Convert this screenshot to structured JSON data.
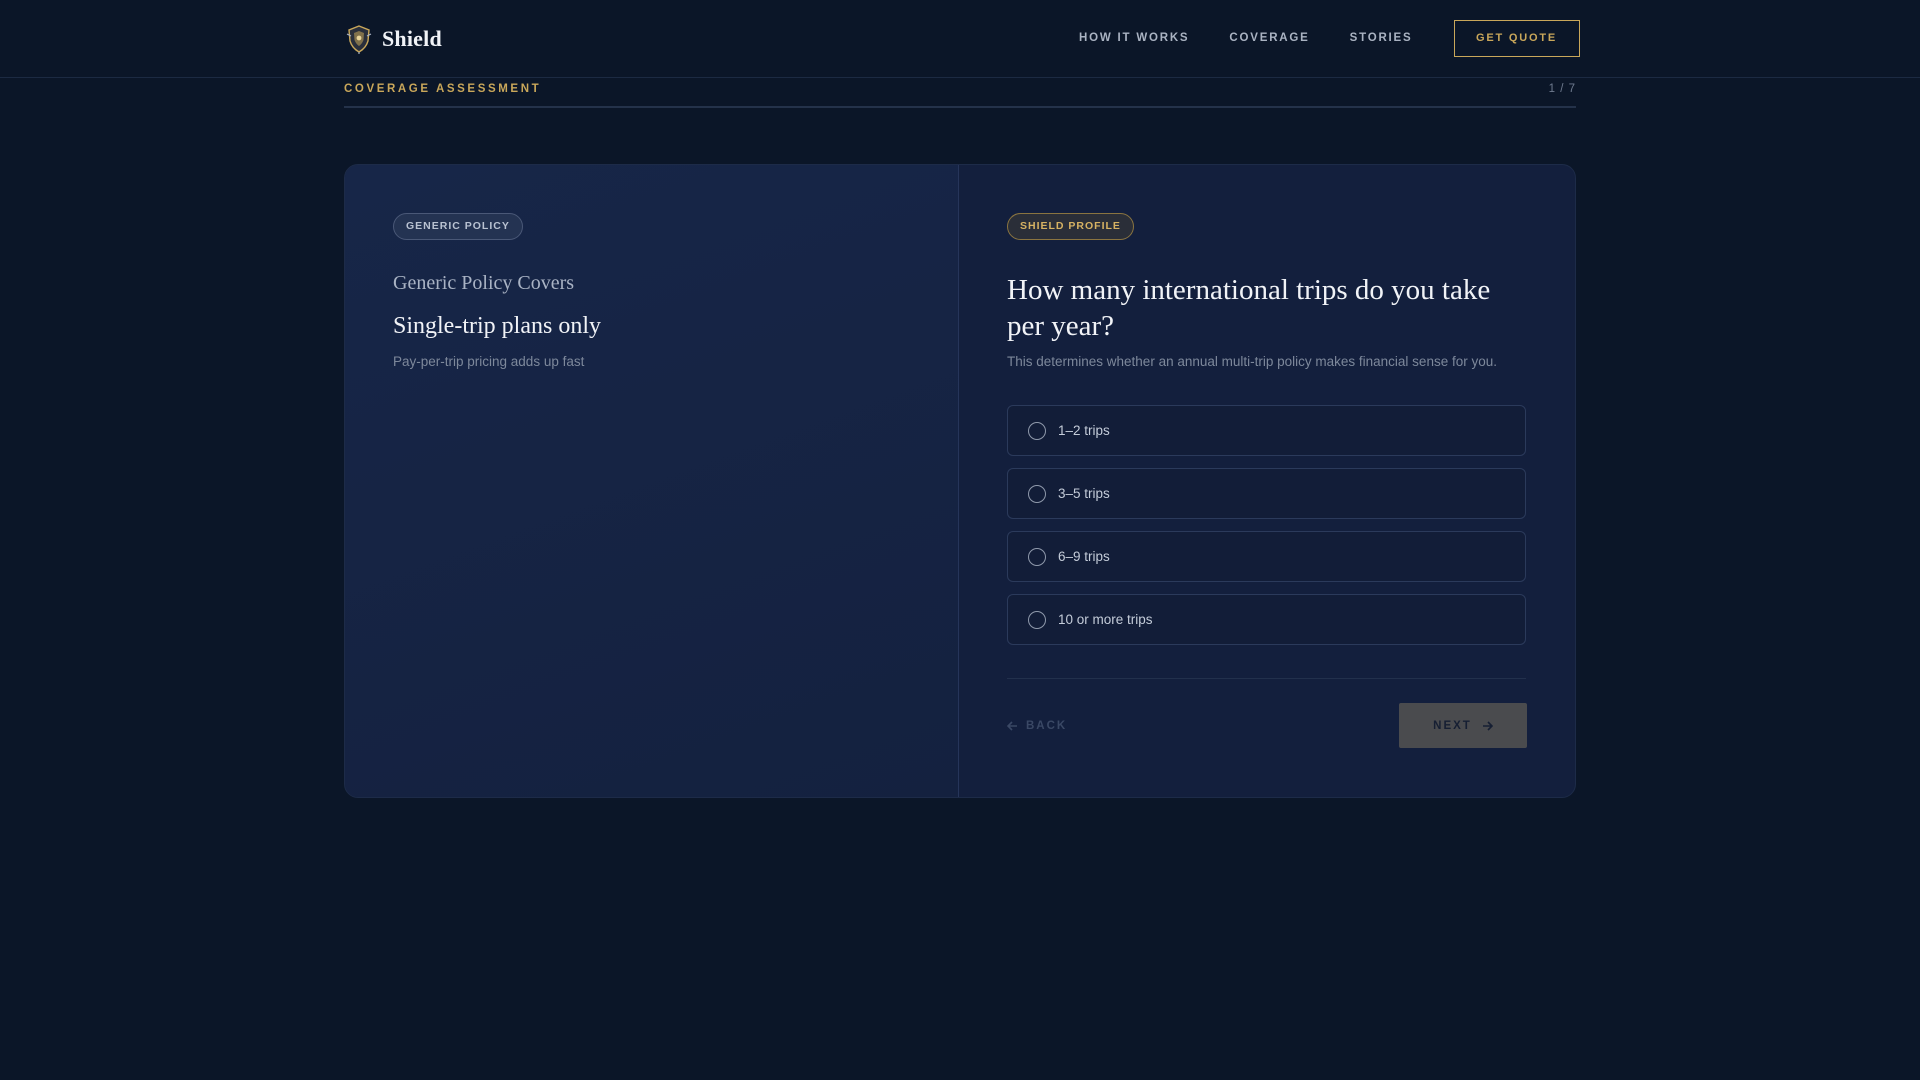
{
  "header": {
    "brand": "Shield",
    "nav": [
      "HOW IT WORKS",
      "COVERAGE",
      "STORIES"
    ],
    "cta": "GET QUOTE"
  },
  "progress": {
    "label": "COVERAGE ASSESSMENT",
    "count": "1 / 7",
    "current": 1,
    "total": 7,
    "fill_fraction": 0
  },
  "left_panel": {
    "badge": "GENERIC POLICY",
    "eyebrow": "Generic Policy Covers",
    "title": "Single-trip plans only",
    "subtitle": "Pay-per-trip pricing adds up fast"
  },
  "right_panel": {
    "badge": "SHIELD PROFILE",
    "question": "How many international trips do you take per year?",
    "help": "This determines whether an annual multi-trip policy makes financial sense for you.",
    "options": [
      "1–2 trips",
      "3–5 trips",
      "6–9 trips",
      "10 or more trips"
    ],
    "back_label": "BACK",
    "next_label": "NEXT"
  },
  "colors": {
    "background": "#0b1628",
    "accent_gold": "#c9a75a",
    "card": "#131f3d"
  },
  "icons": {
    "logo": "shield-crest-icon",
    "back": "arrow-left-icon",
    "next": "arrow-right-icon",
    "radio": "radio-empty-icon"
  }
}
